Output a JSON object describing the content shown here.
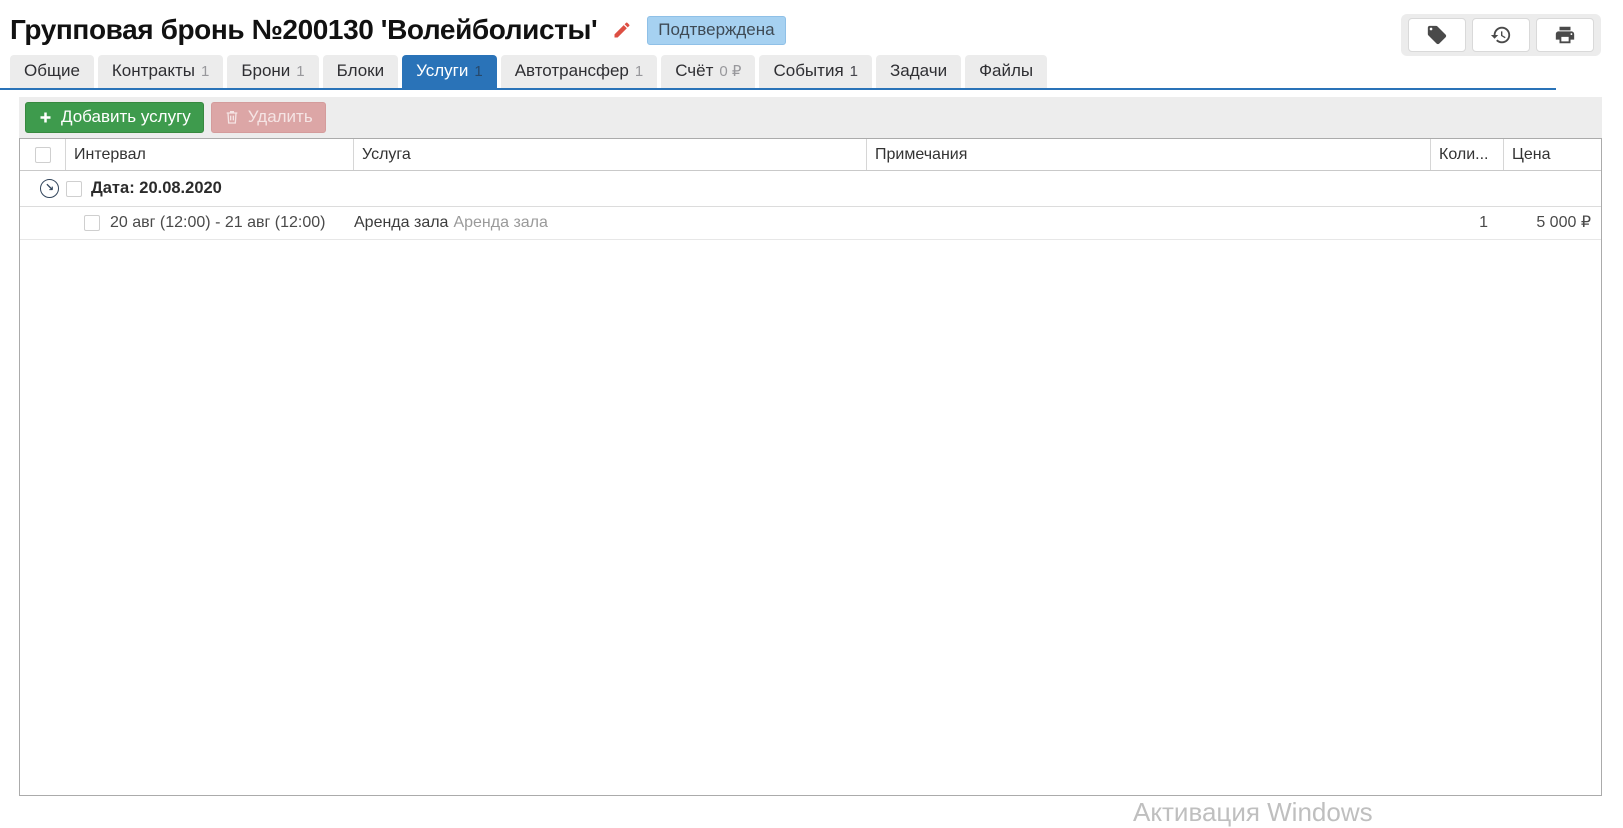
{
  "header": {
    "title": "Групповая бронь №200130 'Волейболисты'",
    "status": "Подтверждена"
  },
  "tabs": [
    {
      "label": "Общие",
      "badge": ""
    },
    {
      "label": "Контракты",
      "badge": "1"
    },
    {
      "label": "Брони",
      "badge": "1"
    },
    {
      "label": "Блоки",
      "badge": ""
    },
    {
      "label": "Услуги",
      "badge": "1",
      "active": true
    },
    {
      "label": "Автотрансфер",
      "badge": "1"
    },
    {
      "label": "Счёт",
      "badge": "0 ₽"
    },
    {
      "label": "События",
      "badge": "1"
    },
    {
      "label": "Задачи",
      "badge": ""
    },
    {
      "label": "Файлы",
      "badge": ""
    }
  ],
  "toolbar": {
    "add_label": "Добавить услугу",
    "delete_label": "Удалить"
  },
  "table": {
    "headers": {
      "interval": "Интервал",
      "service": "Услуга",
      "notes": "Примечания",
      "qty": "Коли...",
      "price": "Цена"
    },
    "group_label": "Дата: 20.08.2020",
    "rows": [
      {
        "interval": "20 авг (12:00) - 21 авг (12:00)",
        "service": "Аренда зала",
        "service_extra": "Аренда зала",
        "notes": "",
        "qty": "1",
        "price": "5 000 ₽"
      }
    ]
  },
  "watermark": "Активация Windows",
  "colors": {
    "accent_blue": "#2a73b8",
    "status_badge_bg": "#a6d1f1",
    "add_button_green": "#3e9b4d",
    "delete_button_pink": "#dca6a6",
    "edit_pencil_red": "#dd4f43"
  }
}
